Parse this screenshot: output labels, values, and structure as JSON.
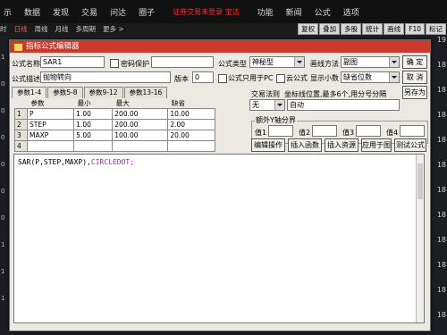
{
  "menubar": {
    "items": [
      "示",
      "数据",
      "发现",
      "交易",
      "问达",
      "圈子"
    ],
    "warning": "证券交易未登录 宝洁",
    "right": [
      "功能",
      "新闻",
      "公式",
      "选项"
    ]
  },
  "toolbar": {
    "left": [
      "时",
      "日线",
      "周线",
      "月线",
      "多周期",
      "更多 >"
    ],
    "right": [
      "复权",
      "叠加",
      "多股",
      "统计",
      "画线",
      "F10",
      "标记"
    ]
  },
  "side_axis": [
    "19",
    "18",
    "18",
    "18",
    "18",
    "18",
    "18",
    "18",
    "18",
    "18",
    "18",
    "18"
  ],
  "left_strip": [
    "1",
    "0",
    "0",
    "0",
    "0",
    "0",
    "0",
    "1",
    "1",
    "1"
  ],
  "dialog": {
    "title": "指标公式编辑器",
    "formula_name_label": "公式名称",
    "formula_name": "SAR1",
    "password_label": "密码保护",
    "desc_label": "公式描述",
    "desc": "抛物转向",
    "version_label": "版本",
    "version": "0",
    "type_label": "公式类型",
    "type_value": "神秘型",
    "draw_label": "画线方法",
    "draw_value": "副图",
    "pc_label": "公式只用于PC",
    "cloud_label": "云公式",
    "decimal_label": "显示小数",
    "decimal_value": "缺省位数",
    "confirm": "确 定",
    "cancel": "取 消",
    "save_as": "另存为",
    "trade_rule_label": "交易法则",
    "trade_rule_value": "无",
    "coord_label": "坐标线位置,最多6个,用分号分隔",
    "coord_value": "自动",
    "y_group_label": "额外Y轴分界",
    "y_labels": [
      "值1",
      "值2",
      "值3",
      "值4"
    ],
    "tabs": [
      "参数1-4",
      "参数5-8",
      "参数9-12",
      "参数13-16"
    ],
    "param_headers": [
      "参数",
      "最小",
      "最大",
      "缺省"
    ],
    "params": [
      {
        "num": "1",
        "name": "P",
        "min": "1.00",
        "max": "200.00",
        "def": "10.00"
      },
      {
        "num": "2",
        "name": "STEP",
        "min": "1.00",
        "max": "200.00",
        "def": "2.00"
      },
      {
        "num": "3",
        "name": "MAXP",
        "min": "5.00",
        "max": "100.00",
        "def": "20.00"
      },
      {
        "num": "4",
        "name": "",
        "min": "",
        "max": "",
        "def": ""
      }
    ],
    "buttons": [
      "编辑操作",
      "插入函数",
      "插入资源",
      "应用于图",
      "测试公式"
    ],
    "code_prefix": "SAR(P,STEP,MAXP),",
    "code_suffix": "CIRCLEDOT;"
  }
}
